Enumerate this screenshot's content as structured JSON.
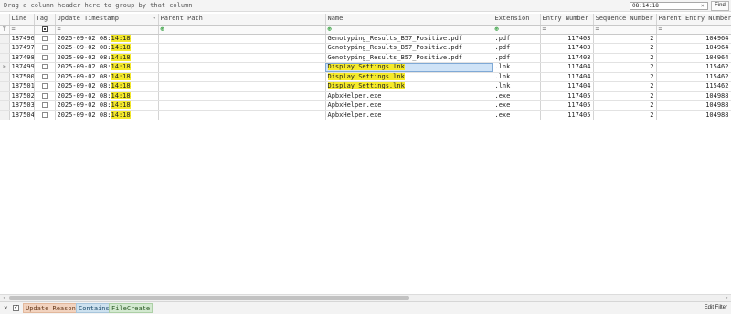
{
  "group_panel": {
    "hint": "Drag a column header here to group by that column"
  },
  "search": {
    "value": "08:14:18",
    "clear_glyph": "×",
    "find_label": "Find"
  },
  "columns": [
    {
      "label": "Line"
    },
    {
      "label": "Tag"
    },
    {
      "label": "Update Timestamp",
      "sort_glyph": "▾"
    },
    {
      "label": "Parent Path"
    },
    {
      "label": "Name"
    },
    {
      "label": "Extension"
    },
    {
      "label": "Entry Number"
    },
    {
      "label": "Sequence Number"
    },
    {
      "label": "Parent Entry Number"
    }
  ],
  "filter_row": {
    "funnel_glyph": "⊤",
    "line_op": "=",
    "ts_op": "=",
    "path_op": "⊕",
    "name_op": "⊕",
    "ext_op": "⊕",
    "entry_op": "=",
    "seq_op": "=",
    "pentry_op": "="
  },
  "rows": [
    {
      "indicator": "",
      "line": "187496",
      "date": "2025-09-02 08:",
      "time_hl": "14:18",
      "name": "Genotyping_Results_B57_Positive.pdf",
      "ext": ".pdf",
      "entry": "117403",
      "seq": "2",
      "parent_entry": "104964"
    },
    {
      "indicator": "",
      "line": "187497",
      "date": "2025-09-02 08:",
      "time_hl": "14:18",
      "name": "Genotyping_Results_B57_Positive.pdf",
      "ext": ".pdf",
      "entry": "117403",
      "seq": "2",
      "parent_entry": "104964"
    },
    {
      "indicator": "",
      "line": "187498",
      "date": "2025-09-02 08:",
      "time_hl": "14:18",
      "name": "Genotyping_Results_B57_Positive.pdf",
      "ext": ".pdf",
      "entry": "117403",
      "seq": "2",
      "parent_entry": "104964"
    },
    {
      "indicator": "»",
      "line": "187499",
      "date": "2025-09-02 08:",
      "time_hl": "14:18",
      "name": "Display Settings.lnk",
      "ext": ".lnk",
      "entry": "117404",
      "seq": "2",
      "parent_entry": "115462",
      "selected": true
    },
    {
      "indicator": "",
      "line": "187500",
      "date": "2025-09-02 08:",
      "time_hl": "14:18",
      "name": "Display Settings.lnk",
      "ext": ".lnk",
      "entry": "117404",
      "seq": "2",
      "parent_entry": "115462"
    },
    {
      "indicator": "",
      "line": "187501",
      "date": "2025-09-02 08:",
      "time_hl": "14:18",
      "name": "Display Settings.lnk",
      "ext": ".lnk",
      "entry": "117404",
      "seq": "2",
      "parent_entry": "115462"
    },
    {
      "indicator": "",
      "line": "187502",
      "date": "2025-09-02 08:",
      "time_hl": "14:18",
      "name": "ApbxHelper.exe",
      "ext": ".exe",
      "entry": "117405",
      "seq": "2",
      "parent_entry": "104988"
    },
    {
      "indicator": "",
      "line": "187503",
      "date": "2025-09-02 08:",
      "time_hl": "14:18",
      "name": "ApbxHelper.exe",
      "ext": ".exe",
      "entry": "117405",
      "seq": "2",
      "parent_entry": "104988"
    },
    {
      "indicator": "",
      "line": "187504",
      "date": "2025-09-02 08:",
      "time_hl": "14:18",
      "name": "ApbxHelper.exe",
      "ext": ".exe",
      "entry": "117405",
      "seq": "2",
      "parent_entry": "104988"
    }
  ],
  "scrollbar": {
    "left_glyph": "◂",
    "right_glyph": "▸"
  },
  "filter_bar": {
    "close_glyph": "×",
    "check_glyph": "✓",
    "chips": [
      "Update Reasons",
      "Contains",
      "FileCreate"
    ],
    "edit_label": "Edit Filter"
  },
  "colors": {
    "search_highlight": "#f5ea2a",
    "selected_row": "#cfe3f7",
    "chip_update_reasons": "#f2d3bf",
    "chip_contains": "#cde1ef",
    "chip_filecreate": "#d3e9d0"
  }
}
